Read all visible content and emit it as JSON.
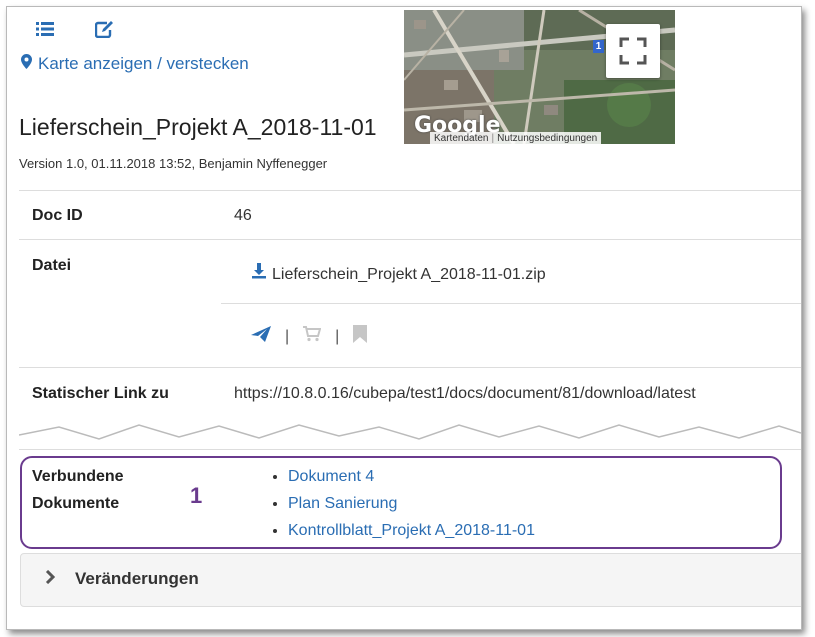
{
  "toolbar": {
    "list_icon": "list-icon",
    "edit_icon": "edit-icon"
  },
  "map": {
    "toggle_label": "Karte anzeigen / verstecken",
    "logo_text": "Google",
    "attribution_data": "Kartendaten",
    "attribution_terms": "Nutzungsbedingungen",
    "marker_label": "1"
  },
  "document": {
    "title": "Lieferschein_Projekt A_2018-11-01",
    "version_line": "Version 1.0, 01.11.2018 13:52, Benjamin Nyffenegger"
  },
  "details": {
    "doc_id_label": "Doc ID",
    "doc_id_value": "46",
    "file_label": "Datei",
    "file_name": "Lieferschein_Projekt A_2018-11-01.zip",
    "action_separator": "|",
    "static_link_label": "Statischer Link zu",
    "static_link_url": "https://10.8.0.16/cubepa/test1/docs/document/81/download/latest"
  },
  "related": {
    "label_line1": "Verbundene",
    "label_line2": "Dokumente",
    "callout_number": "1",
    "items": [
      "Dokument 4",
      "Plan Sanierung",
      "Kontrollblatt_Projekt A_2018-11-01"
    ]
  },
  "changes": {
    "label": "Veränderungen"
  },
  "colors": {
    "link": "#2a6db3",
    "callout": "#6a3b8e",
    "icon_inactive": "#c6c6c6"
  }
}
